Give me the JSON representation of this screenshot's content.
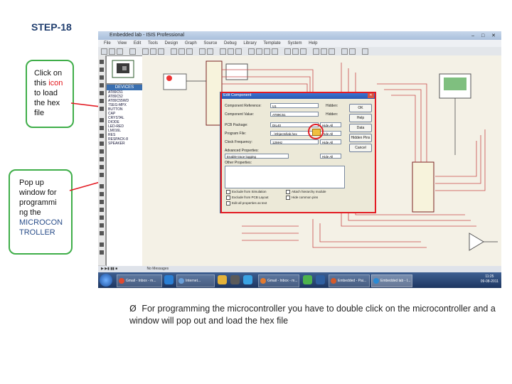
{
  "slide": {
    "title": "STEP-18",
    "callout_icon": {
      "line1": "Click on",
      "line2_a": "this ",
      "line2_b": "icon",
      "line3": "to load",
      "line4": "the hex",
      "line5": "file"
    },
    "callout_popup": {
      "line1": "Pop up",
      "line2": "window for",
      "line3": "programmi",
      "line4": "ng the",
      "line5": "MICROCON",
      "line6": "TROLLER"
    },
    "bullet_arrow": "Ø",
    "bullet_text": "For programming the microcontroller you have to double click on the microcontroller and a window will pop out and load the hex file"
  },
  "colors": {
    "callout_border": "#3fae49",
    "highlight": "#e31b23",
    "title": "#1f3d6e"
  },
  "screenshot": {
    "window_title": "Embedded lab - ISIS Professional",
    "menu": [
      "File",
      "View",
      "Edit",
      "Tools",
      "Design",
      "Graph",
      "Source",
      "Debug",
      "Library",
      "Template",
      "System",
      "Help"
    ],
    "device_panel_header": "DEVICES",
    "devices": [
      "AT89C51",
      "AT89C52",
      "AT89C55WD",
      "7SEG-MPX",
      "BUTTON",
      "CAP",
      "CRYSTAL",
      "DIODE",
      "LED-RED",
      "LM016L",
      "RES",
      "RESPACK-8",
      "SPEAKER"
    ],
    "dialog": {
      "title": "Edit Component",
      "rows": [
        {
          "label": "Component Reference:",
          "value": "U1",
          "hidden": "Hidden:"
        },
        {
          "label": "Component Value:",
          "value": "AT89C51",
          "hidden": "Hidden:"
        },
        {
          "label": "PCB Package:",
          "value": "DIL40",
          "select": "Hide All"
        },
        {
          "label": "Program File:",
          "value": "..\\Objects\\lab.hex",
          "select": "Hide All"
        },
        {
          "label": "Clock Frequency:",
          "value": "12MHz",
          "select": "Hide All"
        },
        {
          "label": "Advanced Properties:",
          "value": "Enable trace logging",
          "select": "Hide All"
        },
        {
          "label": "Other Properties:",
          "value": "",
          "select": ""
        }
      ],
      "buttons": [
        "OK",
        "Help",
        "Data",
        "Hidden Pins",
        "Cancel"
      ],
      "checkboxes": [
        "Exclude from Simulation",
        "Exclude from PCB Layout",
        "Edit all properties as text",
        "Attach hierarchy module",
        "Hide common pins"
      ]
    },
    "status": "No Messages",
    "taskbar_items": [
      "Gmail - Inbox - m...",
      "Internet...",
      "Embedded - Pai...",
      "Embedded lab - I..."
    ],
    "clock_time": "11:25",
    "clock_date": "09-08-2011"
  }
}
